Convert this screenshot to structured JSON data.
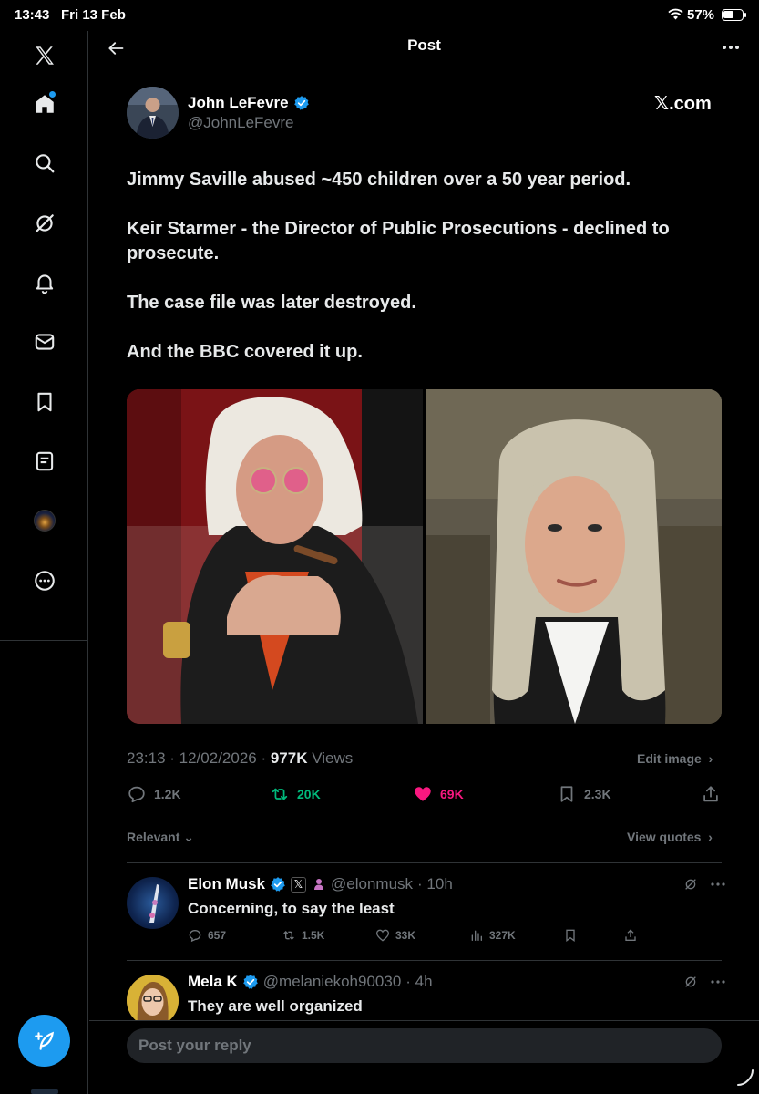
{
  "status_bar": {
    "time": "13:43",
    "date": "Fri 13 Feb",
    "battery": "57%"
  },
  "header": {
    "title": "Post"
  },
  "post": {
    "author_name": "John LeFevre",
    "author_handle": "@JohnLeFevre",
    "source": "𝕏.com",
    "paragraphs": [
      "Jimmy Saville abused ~450 children over a 50 year period.",
      "Keir Starmer - the Director of Public Prosecutions - declined to prosecute.",
      "The case file was later destroyed.",
      "And the BBC covered it up."
    ],
    "timestamp": "23:13 · 12/02/2026 · ",
    "views_count": "977K",
    "views_label": " Views",
    "edit_image": "Edit image",
    "actions": {
      "replies": "1.2K",
      "reposts": "20K",
      "likes": "69K",
      "bookmarks": "2.3K"
    }
  },
  "filters": {
    "relevant": "Relevant",
    "view_quotes": "View quotes"
  },
  "replies": [
    {
      "name": "Elon Musk",
      "handle": "@elonmusk",
      "time": "· 10h",
      "text": "Concerning, to say the least",
      "actions": {
        "replies": "657",
        "reposts": "1.5K",
        "likes": "33K",
        "views": "327K"
      }
    },
    {
      "name": "Mela K",
      "handle": "@melaniekoh90030",
      "time": "· 4h",
      "text": "They are well organized"
    }
  ],
  "reply_bar": {
    "placeholder": "Post your reply"
  },
  "colors": {
    "accent": "#1d9bf0",
    "repost": "#00ba7c",
    "like": "#f91880",
    "muted": "#71767b"
  }
}
